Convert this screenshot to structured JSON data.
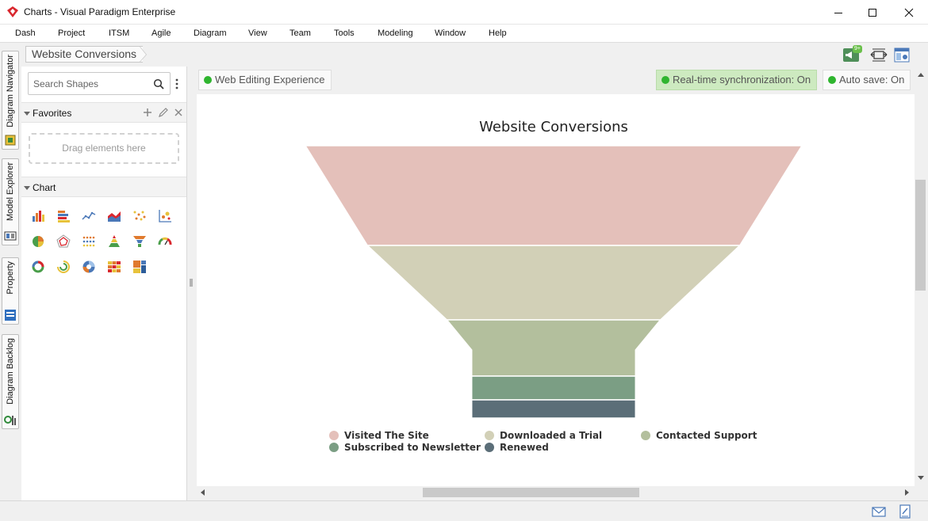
{
  "window": {
    "title": "Charts - Visual Paradigm Enterprise"
  },
  "menu": [
    "Dash",
    "Project",
    "ITSM",
    "Agile",
    "Diagram",
    "View",
    "Team",
    "Tools",
    "Modeling",
    "Window",
    "Help"
  ],
  "side_tabs": [
    "Diagram Navigator",
    "Model Explorer",
    "Property",
    "Diagram Backlog"
  ],
  "breadcrumb": "Website Conversions",
  "toolbar": {
    "notification_badge": "9+"
  },
  "panel": {
    "search_placeholder": "Search Shapes",
    "favorites_title": "Favorites",
    "drop_hint": "Drag elements here",
    "chart_section_title": "Chart",
    "chart_shapes": [
      "bar-chart-icon",
      "horizontal-bar-chart-icon",
      "line-chart-icon",
      "area-chart-icon",
      "scatter-chart-icon",
      "bubble-chart-icon",
      "pie-chart-icon",
      "radar-chart-icon",
      "dot-matrix-chart-icon",
      "pyramid-chart-icon",
      "funnel-chart-icon",
      "gauge-chart-icon",
      "donut-chart-icon",
      "radial-chart-icon",
      "sunburst-chart-icon",
      "heatmap-chart-icon",
      "treemap-chart-icon"
    ]
  },
  "status": {
    "editing": "Web Editing Experience",
    "sync": "Real-time synchronization: On",
    "autosave": "Auto save: On"
  },
  "colors": {
    "status_dot": "#2fb52f",
    "sync_bg": "#cdeac0"
  },
  "chart_data": {
    "type": "funnel",
    "title": "Website Conversions",
    "categories": [
      "Visited The Site",
      "Downloaded a Trial",
      "Contacted Support",
      "Subscribed to Newsletter",
      "Renewed"
    ],
    "values": [
      100,
      75,
      43,
      33,
      33
    ],
    "colors": [
      "#e4c0ba",
      "#d2d0b7",
      "#b3bf9d",
      "#7b9e84",
      "#5b6e78"
    ],
    "legend_position": "bottom"
  }
}
